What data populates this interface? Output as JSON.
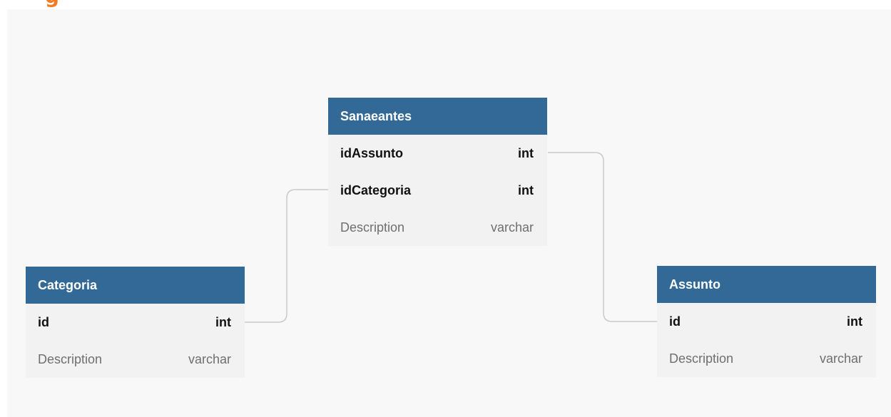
{
  "heading": {
    "fragment": "g"
  },
  "colors": {
    "heading_accent": "#f47b20",
    "entity_header": "#326996",
    "entity_body": "#f2f2f2",
    "canvas": "#f8f8f8",
    "connector": "#c9c9c9"
  },
  "entities": {
    "sanaeantes": {
      "name": "Sanaeantes",
      "fields": [
        {
          "name": "idAssunto",
          "type": "int"
        },
        {
          "name": "idCategoria",
          "type": "int"
        },
        {
          "name": "Description",
          "type": "varchar"
        }
      ]
    },
    "categoria": {
      "name": "Categoria",
      "fields": [
        {
          "name": "id",
          "type": "int"
        },
        {
          "name": "Description",
          "type": "varchar"
        }
      ]
    },
    "assunto": {
      "name": "Assunto",
      "fields": [
        {
          "name": "id",
          "type": "int"
        },
        {
          "name": "Description",
          "type": "varchar"
        }
      ]
    }
  },
  "relationships": [
    {
      "from": "Sanaeantes.idAssunto",
      "to": "Assunto.id"
    },
    {
      "from": "Sanaeantes.idCategoria",
      "to": "Categoria.id"
    }
  ]
}
